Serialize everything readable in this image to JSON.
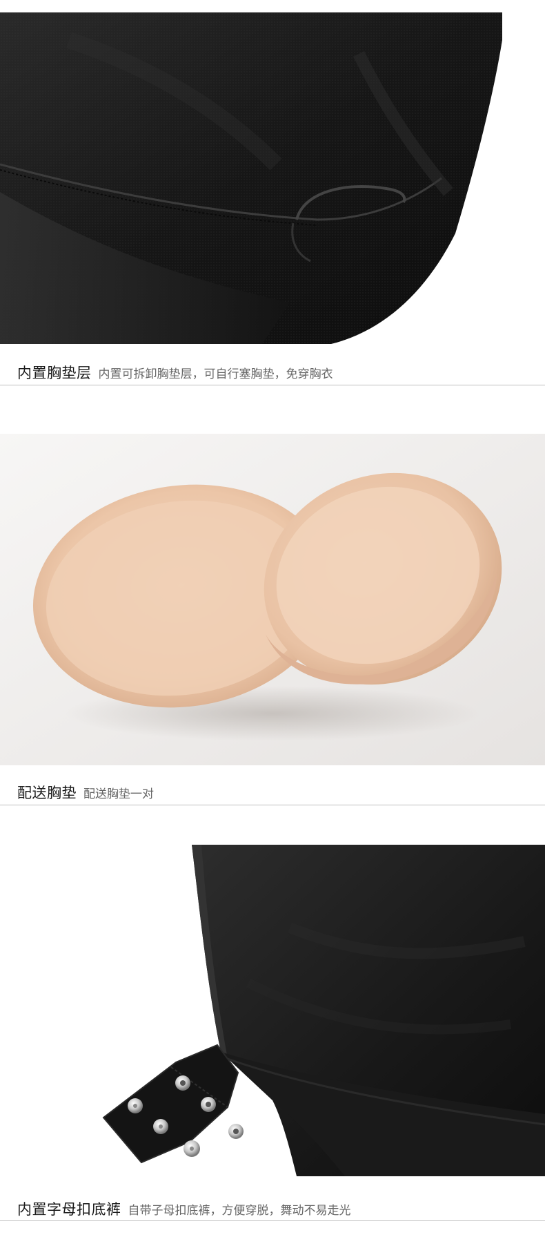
{
  "sections": [
    {
      "image_label": "fabric-mesh-lining-photo",
      "title": "内置胸垫层",
      "description": "内置可拆卸胸垫层，可自行塞胸垫，免穿胸衣"
    },
    {
      "image_label": "bra-pads-photo",
      "title": "配送胸垫",
      "description": "配送胸垫一对"
    },
    {
      "image_label": "snap-crotch-photo",
      "title": "内置字母扣底裤",
      "description": "自带子母扣底裤，方便穿脱，舞动不易走光"
    }
  ],
  "colors": {
    "fabric_black": "#1b1b1b",
    "pad_beige": "#edc9ad",
    "photo_bg_light": "#f0eeec",
    "divider": "#bdbdbd"
  }
}
